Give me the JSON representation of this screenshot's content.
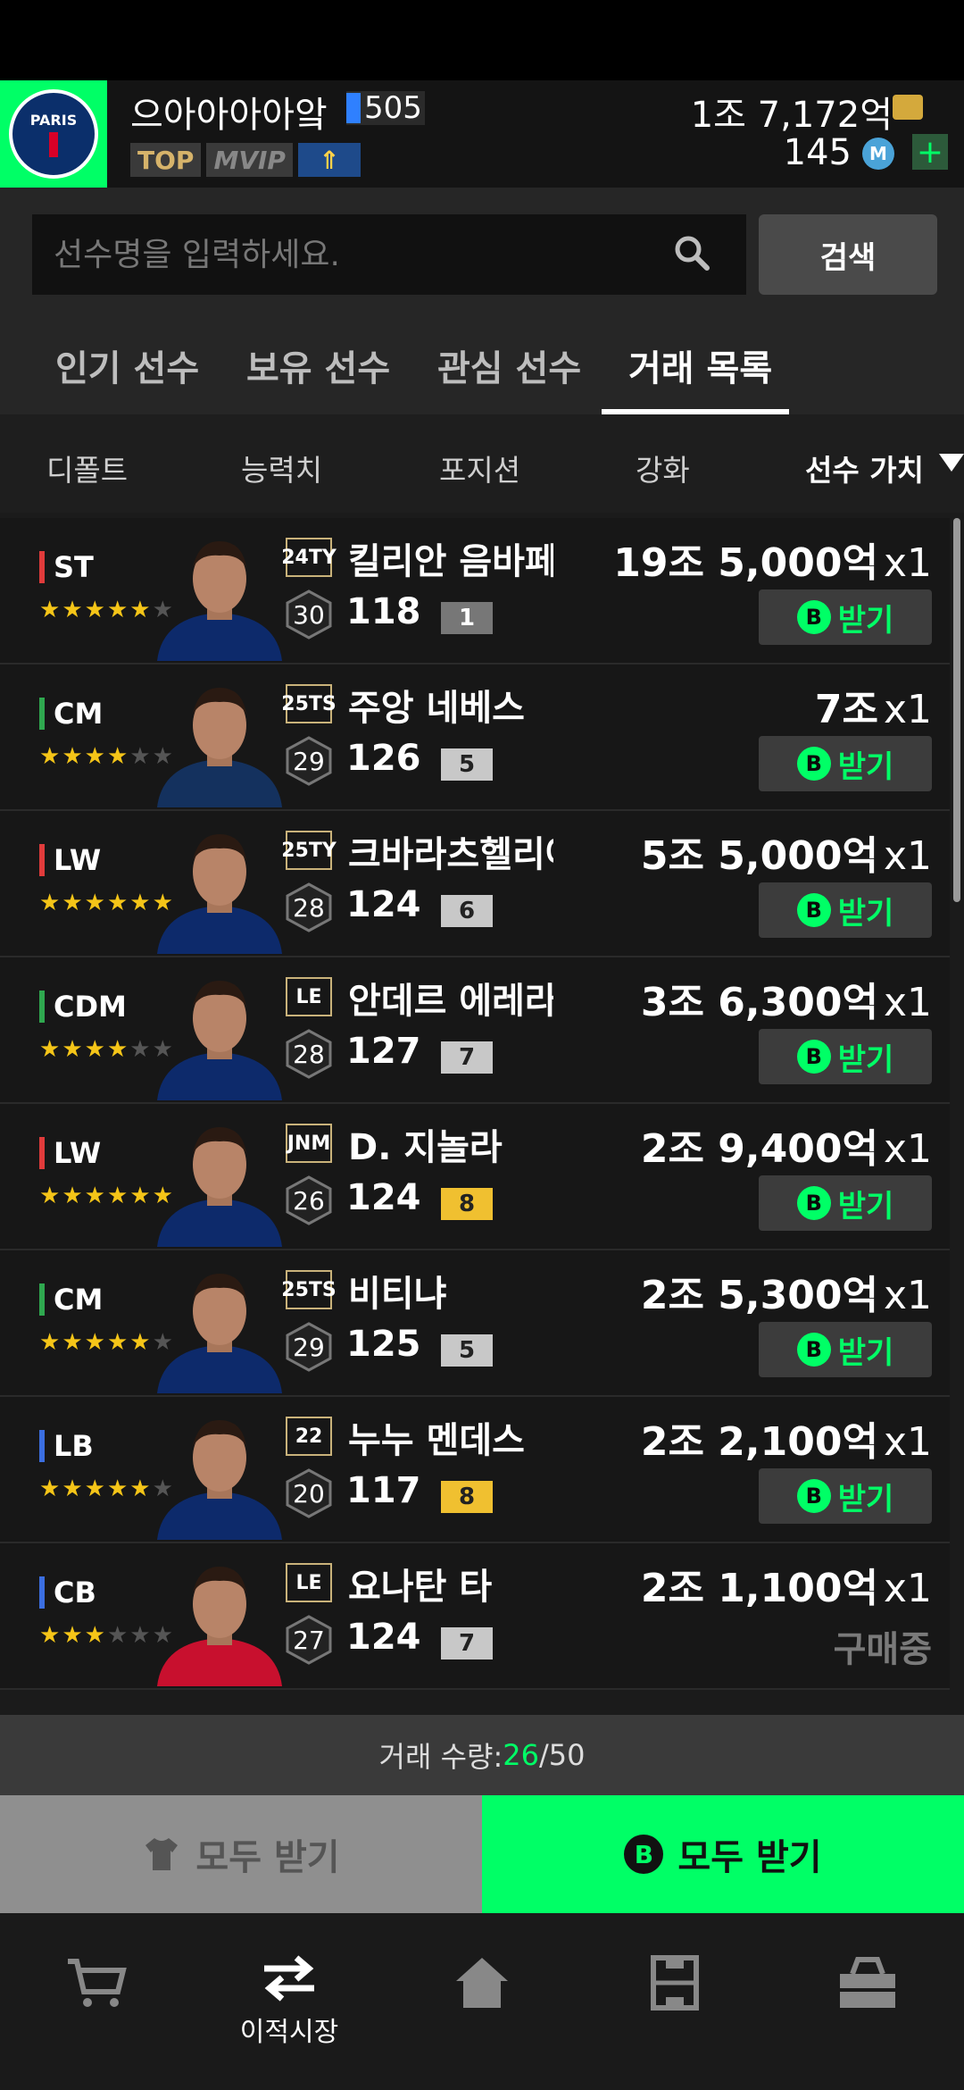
{
  "header": {
    "nickname": "으아아아아앜",
    "level": "505",
    "badges": {
      "top": "TOP",
      "vip": "VIP"
    },
    "bp": "1조 7,172억",
    "mc": "145"
  },
  "search": {
    "placeholder": "선수명을 입력하세요.",
    "button": "검색"
  },
  "tabs": [
    "인기 선수",
    "보유 선수",
    "관심 선수",
    "거래 목록"
  ],
  "sort": [
    "디폴트",
    "능력치",
    "포지션",
    "강화",
    "선수 가치"
  ],
  "players": [
    {
      "pos": "ST",
      "pos_color": "#e03b3b",
      "stars": 5,
      "season": "24TY",
      "name": "킬리안 음바페",
      "age": "30",
      "ovr": "118",
      "grade": "1",
      "grade_style": "dark",
      "price": "19조 5,000억",
      "qty": "x1",
      "action": "받기",
      "shirt": "#0d2a6b"
    },
    {
      "pos": "CM",
      "pos_color": "#2fa84f",
      "stars": 4,
      "season": "25TS",
      "name": "주앙 네베스",
      "age": "29",
      "ovr": "126",
      "grade": "5",
      "grade_style": "gray",
      "price": "7조",
      "qty": "x1",
      "action": "받기",
      "shirt": "#14315e"
    },
    {
      "pos": "LW",
      "pos_color": "#e03b3b",
      "stars": 6,
      "season": "25TY",
      "name": "크바라츠헬리아",
      "age": "28",
      "ovr": "124",
      "grade": "6",
      "grade_style": "gray",
      "price": "5조 5,000억",
      "qty": "x1",
      "action": "받기",
      "shirt": "#0d2a6b"
    },
    {
      "pos": "CDM",
      "pos_color": "#2fa84f",
      "stars": 4,
      "season": "LE",
      "name": "안데르 에레라",
      "age": "28",
      "ovr": "127",
      "grade": "7",
      "grade_style": "gray",
      "price": "3조 6,300억",
      "qty": "x1",
      "action": "받기",
      "shirt": "#0d2a6b"
    },
    {
      "pos": "LW",
      "pos_color": "#e03b3b",
      "stars": 6,
      "season": "JNM",
      "name": "D. 지놀라",
      "age": "26",
      "ovr": "124",
      "grade": "8",
      "grade_style": "gold",
      "price": "2조 9,400억",
      "qty": "x1",
      "action": "받기",
      "shirt": "#0d2a6b"
    },
    {
      "pos": "CM",
      "pos_color": "#2fa84f",
      "stars": 5,
      "season": "25TS",
      "name": "비티냐",
      "age": "29",
      "ovr": "125",
      "grade": "5",
      "grade_style": "gray",
      "price": "2조 5,300억",
      "qty": "x1",
      "action": "받기",
      "shirt": "#0d2a6b"
    },
    {
      "pos": "LB",
      "pos_color": "#3b6ee0",
      "stars": 5,
      "season": "22",
      "name": "누누 멘데스",
      "age": "20",
      "ovr": "117",
      "grade": "8",
      "grade_style": "gold",
      "price": "2조 2,100억",
      "qty": "x1",
      "action": "받기",
      "shirt": "#0d2a6b"
    },
    {
      "pos": "CB",
      "pos_color": "#3b6ee0",
      "stars": 3,
      "season": "LE",
      "name": "요나탄 타",
      "age": "27",
      "ovr": "124",
      "grade": "7",
      "grade_style": "gray",
      "price": "2조 1,100억",
      "qty": "x1",
      "action": "구매중",
      "shirt": "#c8102e"
    }
  ],
  "trade": {
    "label": "거래 수량: ",
    "current": "26",
    "max": "/50"
  },
  "bottom": {
    "left": "모두 받기",
    "right": "모두 받기"
  },
  "nav": [
    "이적시장"
  ]
}
